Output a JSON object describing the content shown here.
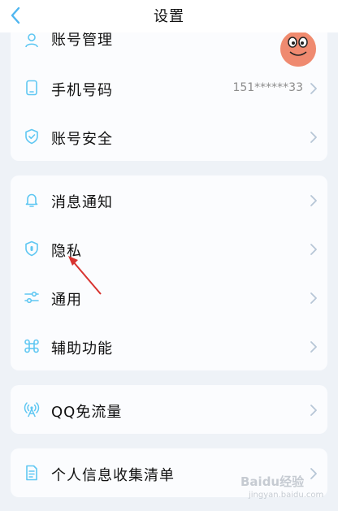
{
  "nav": {
    "title": "设置",
    "back_icon": "chevron-left-icon"
  },
  "account": {
    "rows": [
      {
        "label": "账号管理",
        "icon": "user-icon"
      },
      {
        "label": "手机号码",
        "icon": "phone-icon",
        "value": "151******33"
      },
      {
        "label": "账号安全",
        "icon": "shield-check-icon"
      }
    ]
  },
  "settings": {
    "rows": [
      {
        "label": "消息通知",
        "icon": "bell-icon"
      },
      {
        "label": "隐私",
        "icon": "privacy-shield-icon"
      },
      {
        "label": "通用",
        "icon": "sliders-icon"
      },
      {
        "label": "辅助功能",
        "icon": "command-icon"
      }
    ]
  },
  "traffic": {
    "rows": [
      {
        "label": "QQ免流量",
        "icon": "broadcast-icon"
      }
    ]
  },
  "personal": {
    "rows": [
      {
        "label": "个人信息收集清单",
        "icon": "document-icon"
      }
    ]
  },
  "watermark": {
    "main": "Baidu经验",
    "sub": "jingyan.baidu.com"
  },
  "colors": {
    "accent": "#5fc7f2",
    "chevron": "#b7c6d6",
    "arrow": "#d8332f",
    "background": "#eef2f7"
  }
}
